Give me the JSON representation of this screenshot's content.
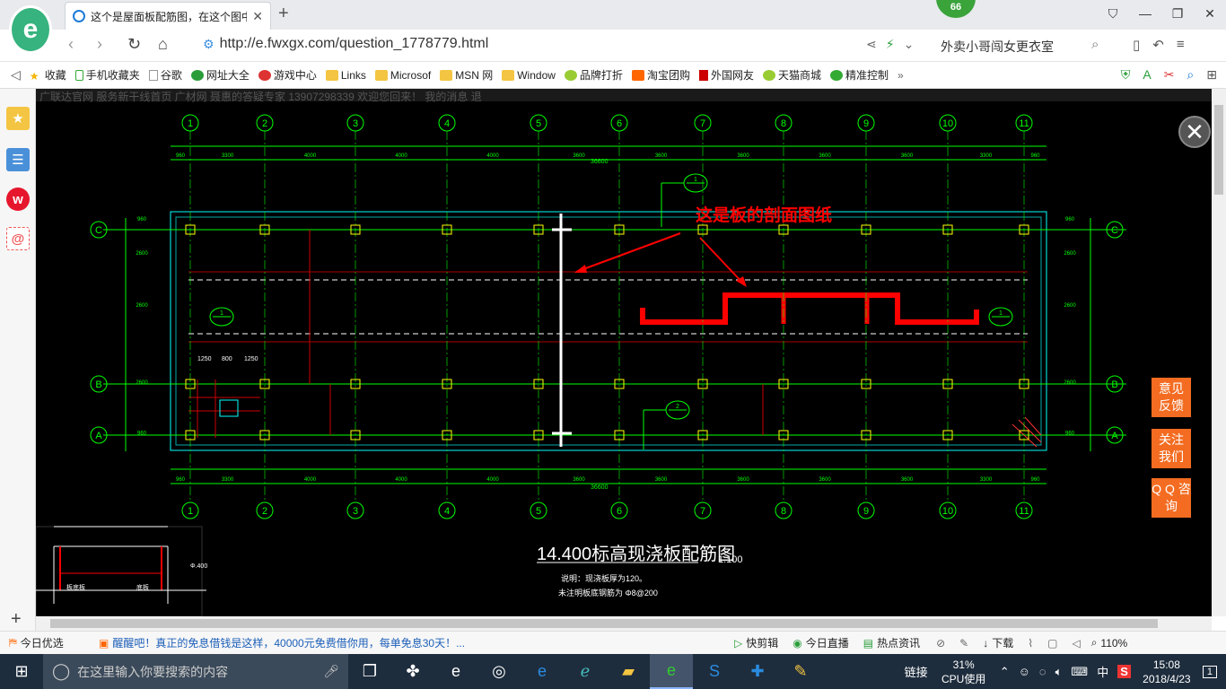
{
  "browser": {
    "tab_title": "这个是屋面板配筋图，在这个图中",
    "badge": "66",
    "url": "http://e.fwxgx.com/question_1778779.html",
    "search_text": "外卖小哥闯女更衣室"
  },
  "bookmarks": [
    "收藏",
    "手机收藏夹",
    "谷歌",
    "网址大全",
    "游戏中心",
    "Links",
    "Microsof",
    "MSN 网",
    "Window",
    "品牌打折",
    "淘宝团购",
    "外国网友",
    "天猫商城",
    "精准控制"
  ],
  "page": {
    "bg_text": "广联达官网    服务新干线首页    广材网                                                                                  聂惠的答疑专家    13907298339 欢迎您回来！    我的消息    退",
    "annotation": "这是板的剖面图纸",
    "drawing_title": "14.400标高现浇板配筋图",
    "drawing_scale": "1:100",
    "drawing_note1": "说明：现浇板厚为120。",
    "drawing_note2": "未注明板底钢筋为  Φ8@200",
    "grid_numbers": [
      "1",
      "2",
      "3",
      "4",
      "5",
      "6",
      "7",
      "8",
      "9",
      "10",
      "11"
    ],
    "grid_letters": [
      "C",
      "B",
      "A"
    ],
    "top_dims": [
      "960",
      "3300",
      "4000",
      "4000",
      "4000",
      "3600",
      "3600",
      "3600",
      "3600",
      "3600",
      "3300",
      "960"
    ],
    "total_dim": "36600",
    "side_dims": [
      "960",
      "2600",
      "2600",
      "2600",
      "960"
    ],
    "local_dims": [
      "1250",
      "800",
      "1250"
    ],
    "callouts": [
      "1",
      "2"
    ],
    "section_labels": [
      "板底板",
      "底板",
      "Φ.400"
    ]
  },
  "side_buttons": [
    "意见 反馈",
    "关注 我们",
    "Q Q 咨询"
  ],
  "statusbar": {
    "left": "今日优选",
    "news": "醒醒吧！真正的免息借钱是这样，40000元免费借你用，每单免息30天！...",
    "items": [
      "快剪辑",
      "今日直播",
      "热点资讯",
      "下载"
    ],
    "zoom": "110%"
  },
  "taskbar": {
    "search_placeholder": "在这里输入你要搜索的内容",
    "tray_link": "链接",
    "cpu_percent": "31%",
    "cpu_label": "CPU使用",
    "lang": "中",
    "time": "15:08",
    "date": "2018/4/23",
    "notif": "1"
  },
  "colors": {
    "cad_bg": "#000000",
    "cad_green": "#00ff00",
    "cad_red": "#ff0000",
    "accent_orange": "#f36c21"
  }
}
